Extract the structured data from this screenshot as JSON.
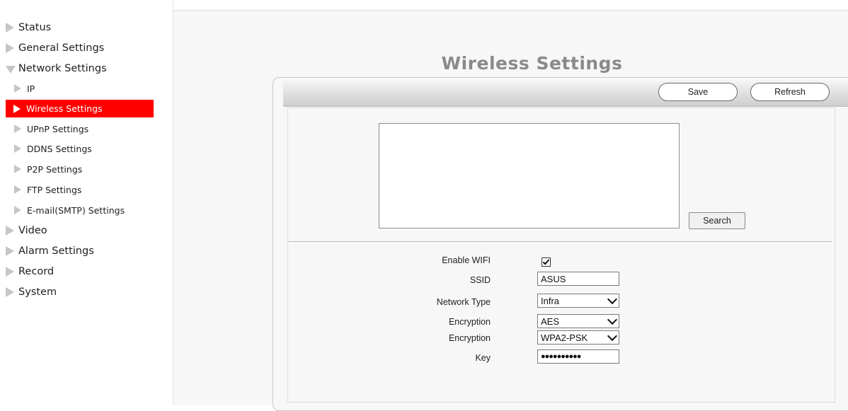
{
  "sidebar": {
    "items": [
      {
        "label": "Status"
      },
      {
        "label": "General Settings"
      },
      {
        "label": "Network Settings"
      },
      {
        "label": "IP"
      },
      {
        "label": "Wireless Settings"
      },
      {
        "label": "UPnP Settings"
      },
      {
        "label": "DDNS Settings"
      },
      {
        "label": "P2P Settings"
      },
      {
        "label": "FTP Settings"
      },
      {
        "label": "E-mail(SMTP) Settings"
      },
      {
        "label": "Video"
      },
      {
        "label": "Alarm Settings"
      },
      {
        "label": "Record"
      },
      {
        "label": "System"
      }
    ],
    "active_item": "Wireless Settings",
    "active_color": "#ff0000"
  },
  "main": {
    "title": "Wireless Settings",
    "toolbar": {
      "save_label": "Save",
      "refresh_label": "Refresh"
    },
    "search_label": "Search",
    "form": {
      "enable_wifi_label": "Enable WIFI",
      "enable_wifi_checked": true,
      "ssid_label": "SSID",
      "ssid_value": "ASUS",
      "network_type_label": "Network Type",
      "network_type_value": "Infra",
      "encryption_label": "Encryption",
      "encryption_value": "AES",
      "encryption2_label": "Encryption",
      "encryption2_value": "WPA2-PSK",
      "key_label": "Key",
      "key_value": "●●●●●●●●●●"
    }
  }
}
